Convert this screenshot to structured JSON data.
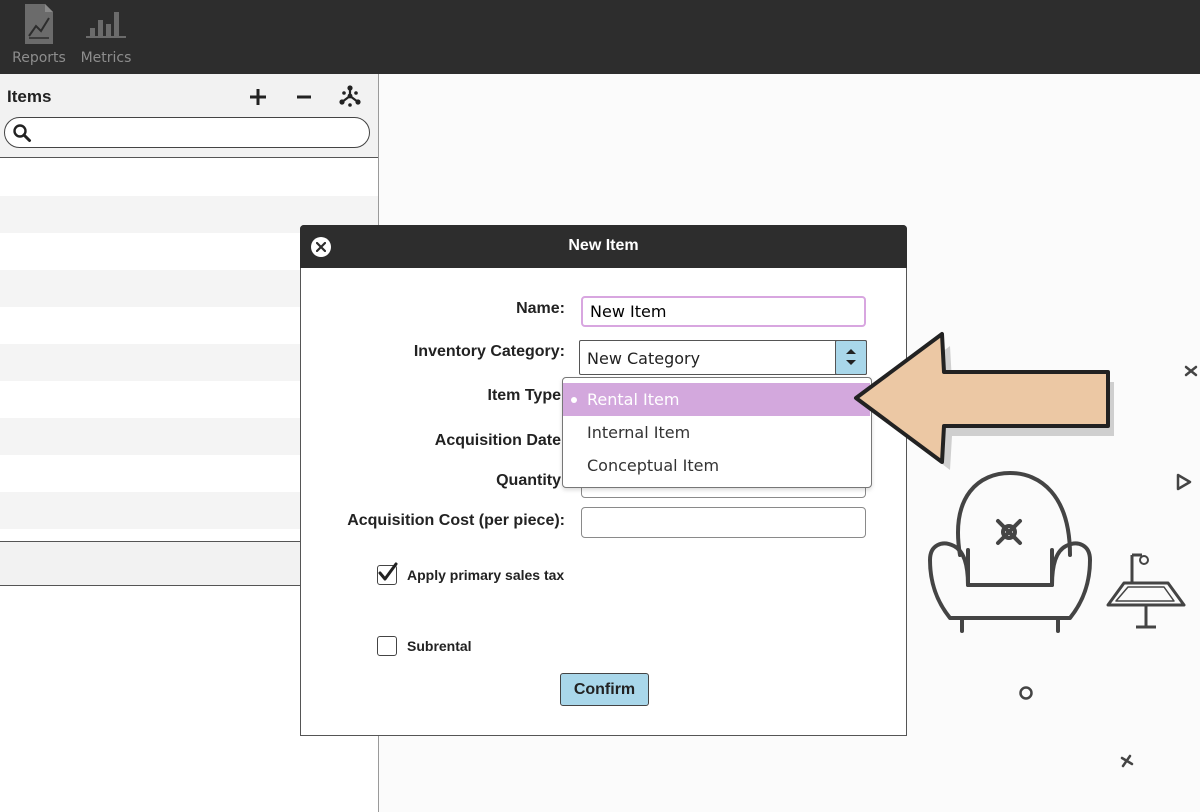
{
  "toolbar": {
    "items": [
      {
        "label": "Reports",
        "icon": "report-chart-icon"
      },
      {
        "label": "Metrics",
        "icon": "bar-chart-icon"
      }
    ]
  },
  "left_panel": {
    "title": "Items",
    "add_icon": "plus-icon",
    "remove_icon": "minus-icon",
    "options_icon": "snowflake-icon",
    "search": {
      "value": "",
      "placeholder": "",
      "icon": "search-icon"
    }
  },
  "dialog": {
    "title": "New Item",
    "close_icon": "close-icon",
    "fields": {
      "name": {
        "label": "Name:",
        "value": "New Item"
      },
      "inventory_category": {
        "label": "Inventory Category:",
        "value": "New Category"
      },
      "item_type": {
        "label": "Item Type"
      },
      "acquisition_date": {
        "label": "Acquisition Date"
      },
      "quantity": {
        "label": "Quantity"
      },
      "acquisition_cost": {
        "label": "Acquisition Cost (per piece):",
        "value": ""
      }
    },
    "item_type_options": [
      {
        "label": "Rental Item",
        "selected": true
      },
      {
        "label": "Internal Item",
        "selected": false
      },
      {
        "label": "Conceptual Item",
        "selected": false
      }
    ],
    "checkboxes": [
      {
        "label": "Apply primary sales tax",
        "checked": true
      },
      {
        "label": "Subrental",
        "checked": false
      }
    ],
    "confirm_label": "Confirm"
  },
  "colors": {
    "toolbar_bg": "#2d2d2d",
    "accent_blue": "#a9d7ea",
    "selection_purple": "#d3a8dd",
    "arrow_fill": "#ecc8a4"
  }
}
